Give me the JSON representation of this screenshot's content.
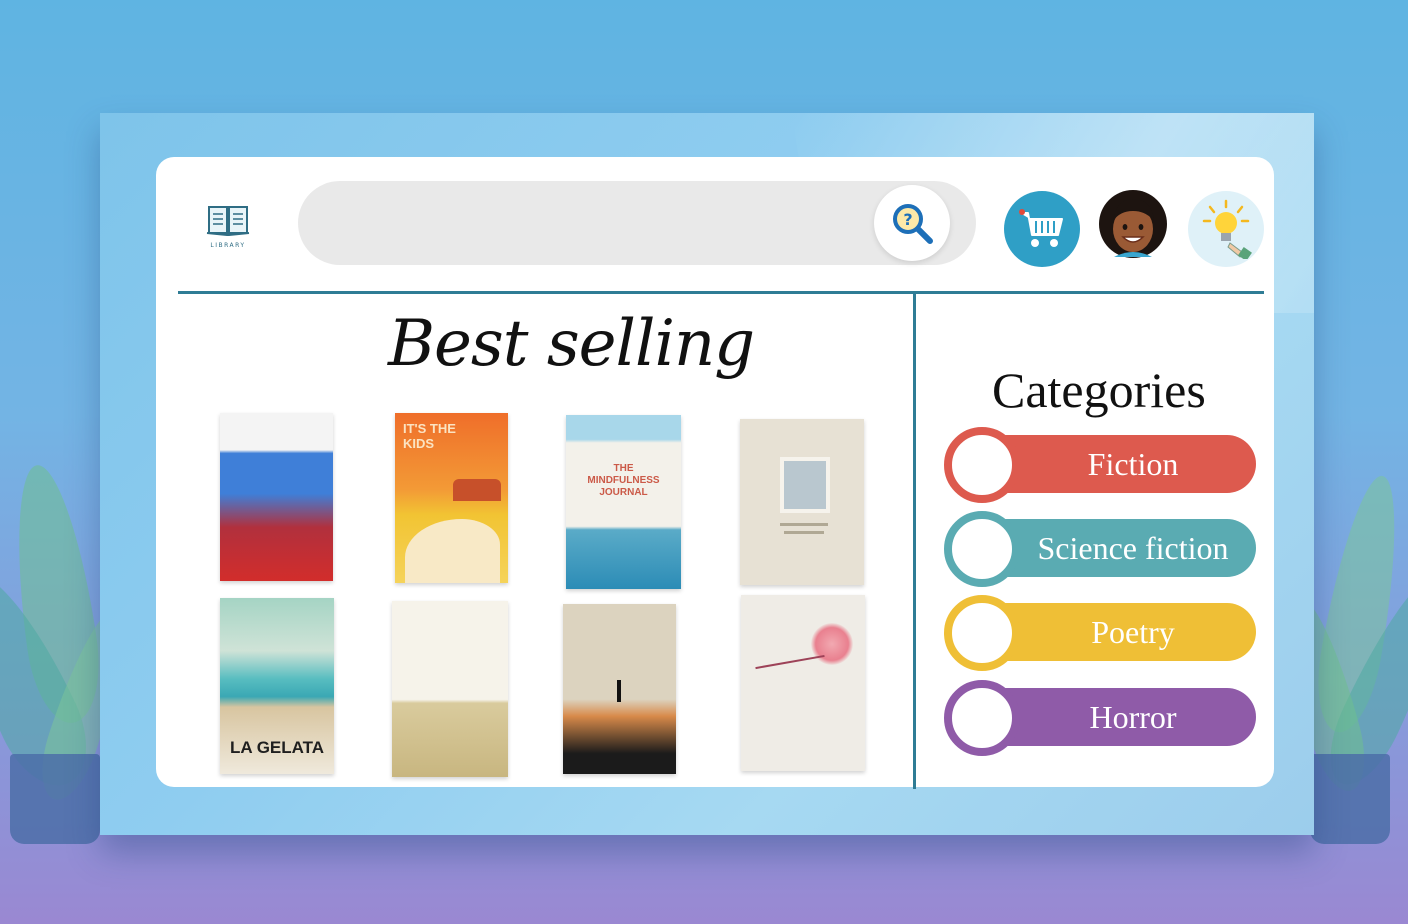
{
  "header": {
    "logo_text": "LIBRARY",
    "search_placeholder": "",
    "icons": {
      "logo": "open-book-icon",
      "search": "magnifier-question-icon",
      "cart": "shopping-cart-icon",
      "profile": "avatar",
      "ideas": "lightbulb-icon"
    }
  },
  "best_selling": {
    "title": "Best selling",
    "books": [
      {
        "cover_text": "",
        "colors": [
          "#3f7fd8",
          "#d22d2b"
        ]
      },
      {
        "cover_text": "IT'S THE KIDS",
        "colors": [
          "#f07a2a",
          "#f3c12e"
        ]
      },
      {
        "cover_text": "THE MINDFULNESS JOURNAL",
        "colors": [
          "#6fb6d8",
          "#2c8cb6"
        ]
      },
      {
        "cover_text": "",
        "colors": [
          "#e8e3d8",
          "#c8bfae"
        ]
      },
      {
        "cover_text": "LA GELATA",
        "colors": [
          "#5fc3c0",
          "#d9c7a2"
        ]
      },
      {
        "cover_text": "",
        "colors": [
          "#f4f0e6",
          "#c9b98a"
        ]
      },
      {
        "cover_text": "",
        "colors": [
          "#ddd5c2",
          "#d88a4a"
        ]
      },
      {
        "cover_text": "",
        "colors": [
          "#efece7",
          "#e07f8a"
        ]
      }
    ]
  },
  "categories": {
    "title": "Categories",
    "items": [
      {
        "label": "Fiction",
        "color": "#dd5a4e"
      },
      {
        "label": "Science fiction",
        "color": "#5aabb2"
      },
      {
        "label": "Poetry",
        "color": "#efbf36"
      },
      {
        "label": "Horror",
        "color": "#8f5ba8"
      }
    ]
  }
}
